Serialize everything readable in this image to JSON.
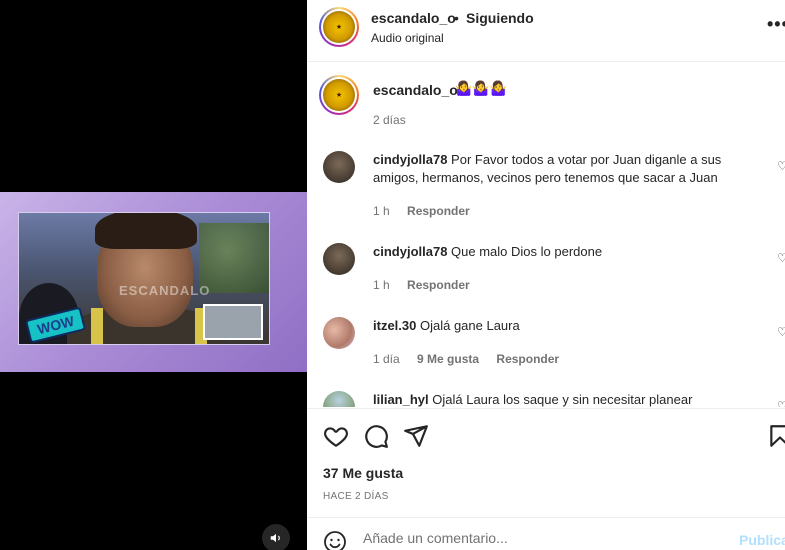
{
  "post": {
    "username": "escandalo_o",
    "separator": "•",
    "follow_status": "Siguiendo",
    "audio": "Audio original",
    "more": "•••",
    "caption_emoji": "🤷‍♀️🤷‍♀️🤷‍♀️",
    "caption_time": "2 días"
  },
  "video": {
    "watermark": "ESCANDALO",
    "sticker": "WOW",
    "sound_icon": "speaker-icon"
  },
  "comments": [
    {
      "user": "cindyjolla78",
      "text": "Por Favor todos a votar por Juan diganle a sus amigos, hermanos, vecinos pero tenemos que sacar a Juan",
      "time": "1 h",
      "likes": "",
      "reply": "Responder"
    },
    {
      "user": "cindyjolla78",
      "text": "Que malo Dios lo perdone",
      "time": "1 h",
      "likes": "",
      "reply": "Responder"
    },
    {
      "user": "itzel.30",
      "text": "Ojalá gane Laura",
      "time": "1 día",
      "likes": "9 Me gusta",
      "reply": "Responder"
    },
    {
      "user": "lilian_hyl",
      "text": "Ojalá Laura los saque y sin necesitar planear",
      "time": "",
      "likes": "",
      "reply": ""
    }
  ],
  "actions": {
    "likes": "37 Me gusta",
    "when": "HACE 2 DÍAS"
  },
  "composer": {
    "placeholder": "Añade un comentario...",
    "publish": "Publicar"
  },
  "colors": {
    "link_disabled": "#b2dffc",
    "muted": "#737373",
    "text": "#262626"
  }
}
